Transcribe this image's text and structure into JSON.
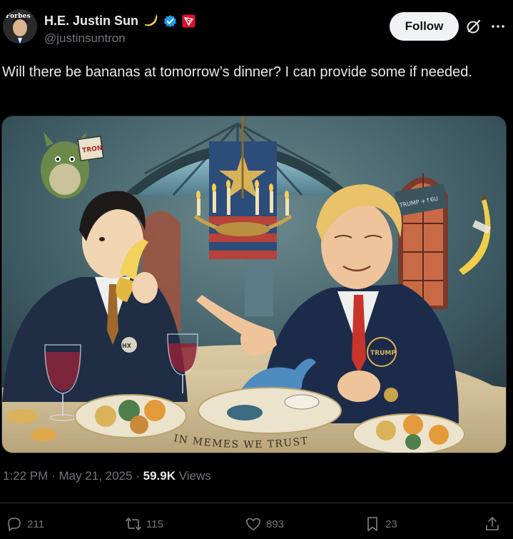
{
  "author": {
    "display_name": "H.E. Justin Sun",
    "handle": "@justinsuntron",
    "avatar_brand": "Forbes"
  },
  "header": {
    "follow_label": "Follow"
  },
  "tweet": {
    "text": "Will there be bananas at tomorrow’s dinner? I can provide some if needed.",
    "image_texts": {
      "banner": "IN MEMES WE TRUST",
      "badge": "TRUMP",
      "sign": "TRON",
      "screen_text": "TRUMP +↑6U",
      "pin": "HX"
    }
  },
  "meta": {
    "time": "1:22 PM",
    "date": "May 21, 2025",
    "views": "59.9K",
    "views_label": "Views",
    "sep": "·"
  },
  "actions": {
    "replies": "211",
    "reposts": "115",
    "likes": "893",
    "bookmarks": "23"
  },
  "colors": {
    "background": "#000000",
    "text": "#e7e9ea",
    "secondary": "#71767b",
    "verified": "#1d9bf0",
    "follow_bg": "#eff3f4"
  }
}
